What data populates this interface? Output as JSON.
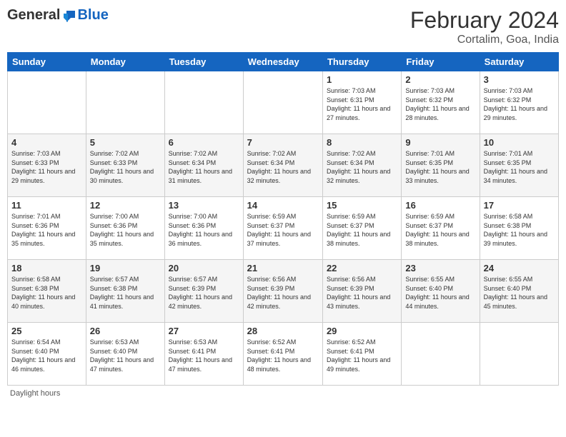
{
  "header": {
    "logo_general": "General",
    "logo_blue": "Blue",
    "month_year": "February 2024",
    "location": "Cortalim, Goa, India"
  },
  "days_of_week": [
    "Sunday",
    "Monday",
    "Tuesday",
    "Wednesday",
    "Thursday",
    "Friday",
    "Saturday"
  ],
  "weeks": [
    [
      {
        "day": "",
        "info": ""
      },
      {
        "day": "",
        "info": ""
      },
      {
        "day": "",
        "info": ""
      },
      {
        "day": "",
        "info": ""
      },
      {
        "day": "1",
        "info": "Sunrise: 7:03 AM\nSunset: 6:31 PM\nDaylight: 11 hours and 27 minutes."
      },
      {
        "day": "2",
        "info": "Sunrise: 7:03 AM\nSunset: 6:32 PM\nDaylight: 11 hours and 28 minutes."
      },
      {
        "day": "3",
        "info": "Sunrise: 7:03 AM\nSunset: 6:32 PM\nDaylight: 11 hours and 29 minutes."
      }
    ],
    [
      {
        "day": "4",
        "info": "Sunrise: 7:03 AM\nSunset: 6:33 PM\nDaylight: 11 hours and 29 minutes."
      },
      {
        "day": "5",
        "info": "Sunrise: 7:02 AM\nSunset: 6:33 PM\nDaylight: 11 hours and 30 minutes."
      },
      {
        "day": "6",
        "info": "Sunrise: 7:02 AM\nSunset: 6:34 PM\nDaylight: 11 hours and 31 minutes."
      },
      {
        "day": "7",
        "info": "Sunrise: 7:02 AM\nSunset: 6:34 PM\nDaylight: 11 hours and 32 minutes."
      },
      {
        "day": "8",
        "info": "Sunrise: 7:02 AM\nSunset: 6:34 PM\nDaylight: 11 hours and 32 minutes."
      },
      {
        "day": "9",
        "info": "Sunrise: 7:01 AM\nSunset: 6:35 PM\nDaylight: 11 hours and 33 minutes."
      },
      {
        "day": "10",
        "info": "Sunrise: 7:01 AM\nSunset: 6:35 PM\nDaylight: 11 hours and 34 minutes."
      }
    ],
    [
      {
        "day": "11",
        "info": "Sunrise: 7:01 AM\nSunset: 6:36 PM\nDaylight: 11 hours and 35 minutes."
      },
      {
        "day": "12",
        "info": "Sunrise: 7:00 AM\nSunset: 6:36 PM\nDaylight: 11 hours and 35 minutes."
      },
      {
        "day": "13",
        "info": "Sunrise: 7:00 AM\nSunset: 6:36 PM\nDaylight: 11 hours and 36 minutes."
      },
      {
        "day": "14",
        "info": "Sunrise: 6:59 AM\nSunset: 6:37 PM\nDaylight: 11 hours and 37 minutes."
      },
      {
        "day": "15",
        "info": "Sunrise: 6:59 AM\nSunset: 6:37 PM\nDaylight: 11 hours and 38 minutes."
      },
      {
        "day": "16",
        "info": "Sunrise: 6:59 AM\nSunset: 6:37 PM\nDaylight: 11 hours and 38 minutes."
      },
      {
        "day": "17",
        "info": "Sunrise: 6:58 AM\nSunset: 6:38 PM\nDaylight: 11 hours and 39 minutes."
      }
    ],
    [
      {
        "day": "18",
        "info": "Sunrise: 6:58 AM\nSunset: 6:38 PM\nDaylight: 11 hours and 40 minutes."
      },
      {
        "day": "19",
        "info": "Sunrise: 6:57 AM\nSunset: 6:38 PM\nDaylight: 11 hours and 41 minutes."
      },
      {
        "day": "20",
        "info": "Sunrise: 6:57 AM\nSunset: 6:39 PM\nDaylight: 11 hours and 42 minutes."
      },
      {
        "day": "21",
        "info": "Sunrise: 6:56 AM\nSunset: 6:39 PM\nDaylight: 11 hours and 42 minutes."
      },
      {
        "day": "22",
        "info": "Sunrise: 6:56 AM\nSunset: 6:39 PM\nDaylight: 11 hours and 43 minutes."
      },
      {
        "day": "23",
        "info": "Sunrise: 6:55 AM\nSunset: 6:40 PM\nDaylight: 11 hours and 44 minutes."
      },
      {
        "day": "24",
        "info": "Sunrise: 6:55 AM\nSunset: 6:40 PM\nDaylight: 11 hours and 45 minutes."
      }
    ],
    [
      {
        "day": "25",
        "info": "Sunrise: 6:54 AM\nSunset: 6:40 PM\nDaylight: 11 hours and 46 minutes."
      },
      {
        "day": "26",
        "info": "Sunrise: 6:53 AM\nSunset: 6:40 PM\nDaylight: 11 hours and 47 minutes."
      },
      {
        "day": "27",
        "info": "Sunrise: 6:53 AM\nSunset: 6:41 PM\nDaylight: 11 hours and 47 minutes."
      },
      {
        "day": "28",
        "info": "Sunrise: 6:52 AM\nSunset: 6:41 PM\nDaylight: 11 hours and 48 minutes."
      },
      {
        "day": "29",
        "info": "Sunrise: 6:52 AM\nSunset: 6:41 PM\nDaylight: 11 hours and 49 minutes."
      },
      {
        "day": "",
        "info": ""
      },
      {
        "day": "",
        "info": ""
      }
    ]
  ],
  "footer": {
    "daylight_hours": "Daylight hours"
  }
}
